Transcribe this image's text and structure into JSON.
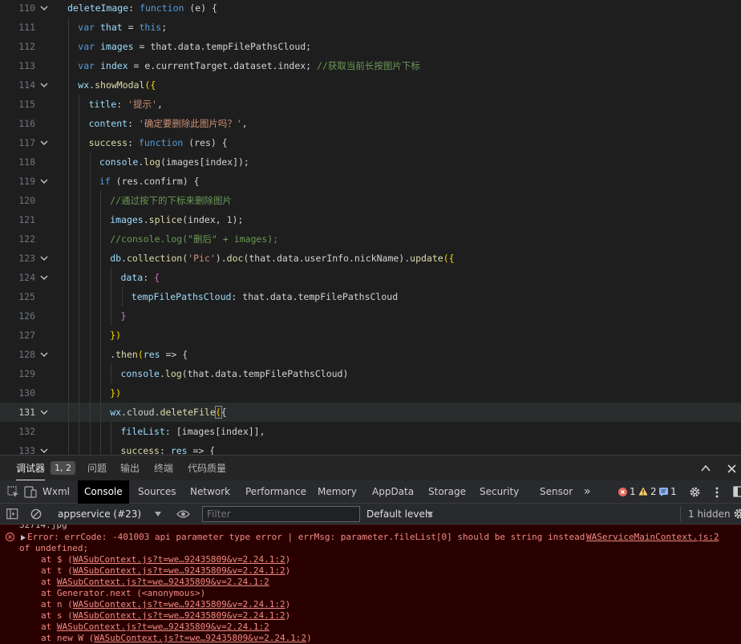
{
  "editor": {
    "lines": [
      {
        "num": "110",
        "indent": 0,
        "fold": true,
        "tokens": [
          [
            "prop",
            "deleteImage"
          ],
          [
            "punc",
            ": "
          ],
          [
            "kw",
            "function"
          ],
          [
            "punc",
            " (e) {"
          ]
        ]
      },
      {
        "num": "111",
        "indent": 1,
        "fold": false,
        "tokens": [
          [
            "kw",
            "var "
          ],
          [
            "var",
            "that"
          ],
          [
            "punc",
            " = "
          ],
          [
            "kw",
            "this"
          ],
          [
            "punc",
            ";"
          ]
        ]
      },
      {
        "num": "112",
        "indent": 1,
        "fold": false,
        "tokens": [
          [
            "kw",
            "var "
          ],
          [
            "var",
            "images"
          ],
          [
            "punc",
            " = that.data.tempFilePathsCloud;"
          ]
        ]
      },
      {
        "num": "113",
        "indent": 1,
        "fold": false,
        "tokens": [
          [
            "kw",
            "var "
          ],
          [
            "var",
            "index"
          ],
          [
            "punc",
            " = e.currentTarget.dataset.index; "
          ],
          [
            "com",
            "//获取当前长按图片下标"
          ]
        ]
      },
      {
        "num": "114",
        "indent": 1,
        "fold": true,
        "tokens": [
          [
            "var",
            "wx"
          ],
          [
            "punc",
            "."
          ],
          [
            "fn",
            "showModal"
          ],
          [
            "yel",
            "({"
          ]
        ]
      },
      {
        "num": "115",
        "indent": 2,
        "fold": false,
        "tokens": [
          [
            "prop",
            "title"
          ],
          [
            "punc",
            ": "
          ],
          [
            "str",
            "'提示'"
          ],
          [
            "punc",
            ","
          ]
        ]
      },
      {
        "num": "116",
        "indent": 2,
        "fold": false,
        "tokens": [
          [
            "prop",
            "content"
          ],
          [
            "punc",
            ": "
          ],
          [
            "str",
            "'确定要删除此图片吗？'"
          ],
          [
            "punc",
            ","
          ]
        ]
      },
      {
        "num": "117",
        "indent": 2,
        "fold": true,
        "tokens": [
          [
            "fn",
            "success"
          ],
          [
            "punc",
            ": "
          ],
          [
            "kw",
            "function"
          ],
          [
            "punc",
            " (res) {"
          ]
        ]
      },
      {
        "num": "118",
        "indent": 3,
        "fold": false,
        "tokens": [
          [
            "var",
            "console"
          ],
          [
            "punc",
            "."
          ],
          [
            "fn",
            "log"
          ],
          [
            "punc",
            "(images[index]);"
          ]
        ]
      },
      {
        "num": "119",
        "indent": 3,
        "fold": true,
        "tokens": [
          [
            "kw",
            "if"
          ],
          [
            "punc",
            " (res.confirm) {"
          ]
        ]
      },
      {
        "num": "120",
        "indent": 4,
        "fold": false,
        "tokens": [
          [
            "com",
            "//通过按下的下标来删除图片"
          ]
        ]
      },
      {
        "num": "121",
        "indent": 4,
        "fold": false,
        "tokens": [
          [
            "var",
            "images"
          ],
          [
            "punc",
            "."
          ],
          [
            "fn",
            "splice"
          ],
          [
            "punc",
            "(index, "
          ],
          [
            "num",
            "1"
          ],
          [
            "punc",
            ");"
          ]
        ]
      },
      {
        "num": "122",
        "indent": 4,
        "fold": false,
        "tokens": [
          [
            "com",
            "//console.log(\"删后\" + images);"
          ]
        ]
      },
      {
        "num": "123",
        "indent": 4,
        "fold": true,
        "tokens": [
          [
            "var",
            "db"
          ],
          [
            "punc",
            "."
          ],
          [
            "fn",
            "collection"
          ],
          [
            "punc",
            "("
          ],
          [
            "str",
            "'Pic'"
          ],
          [
            "punc",
            ")."
          ],
          [
            "fn",
            "doc"
          ],
          [
            "punc",
            "(that.data.userInfo.nickName)."
          ],
          [
            "fn",
            "update"
          ],
          [
            "yel",
            "({"
          ]
        ]
      },
      {
        "num": "124",
        "indent": 5,
        "fold": true,
        "tokens": [
          [
            "prop",
            "data"
          ],
          [
            "punc",
            ": "
          ],
          [
            "pur",
            "{"
          ]
        ]
      },
      {
        "num": "125",
        "indent": 6,
        "fold": false,
        "tokens": [
          [
            "prop",
            "tempFilePathsCloud"
          ],
          [
            "punc",
            ": that.data.tempFilePathsCloud"
          ]
        ]
      },
      {
        "num": "126",
        "indent": 5,
        "fold": false,
        "tokens": [
          [
            "pur",
            "}"
          ]
        ]
      },
      {
        "num": "127",
        "indent": 4,
        "fold": false,
        "tokens": [
          [
            "yel",
            "})"
          ]
        ]
      },
      {
        "num": "128",
        "indent": 4,
        "fold": true,
        "tokens": [
          [
            "punc",
            "."
          ],
          [
            "fn",
            "then"
          ],
          [
            "yel",
            "("
          ],
          [
            "var",
            "res"
          ],
          [
            "punc",
            " => {"
          ]
        ]
      },
      {
        "num": "129",
        "indent": 5,
        "fold": false,
        "tokens": [
          [
            "var",
            "console"
          ],
          [
            "punc",
            "."
          ],
          [
            "fn",
            "log"
          ],
          [
            "punc",
            "(that.data.tempFilePathsCloud)"
          ]
        ]
      },
      {
        "num": "130",
        "indent": 4,
        "fold": false,
        "tokens": [
          [
            "yel",
            "})"
          ]
        ]
      },
      {
        "num": "131",
        "indent": 4,
        "fold": true,
        "current": true,
        "tokens": [
          [
            "var",
            "wx"
          ],
          [
            "punc",
            ".cloud."
          ],
          [
            "fn",
            "deleteFile"
          ],
          [
            "yel",
            "("
          ],
          [
            "punc",
            "{"
          ]
        ]
      },
      {
        "num": "132",
        "indent": 5,
        "fold": false,
        "tokens": [
          [
            "prop",
            "fileList"
          ],
          [
            "punc",
            ": [images[index]],"
          ]
        ]
      },
      {
        "num": "133",
        "indent": 5,
        "fold": true,
        "tokens": [
          [
            "fn",
            "success"
          ],
          [
            "punc",
            ": "
          ],
          [
            "var",
            "res"
          ],
          [
            "punc",
            " => {"
          ]
        ]
      }
    ]
  },
  "panel": {
    "tabs": [
      {
        "label": "调试器",
        "active": true
      },
      {
        "label": "问题",
        "active": false
      },
      {
        "label": "输出",
        "active": false
      },
      {
        "label": "终端",
        "active": false
      },
      {
        "label": "代码质量",
        "active": false
      }
    ],
    "debugger_badge": "1, 2"
  },
  "devtools": {
    "tabs": [
      "Wxml",
      "Console",
      "Sources",
      "Network",
      "Performance",
      "Memory",
      "AppData",
      "Storage",
      "Security",
      "Sensor"
    ],
    "active_tab": "Console",
    "overflow": "»",
    "error_count": "1",
    "warning_count": "2",
    "info_count": "1"
  },
  "console_toolbar": {
    "context": "appservice (#23)",
    "filter_placeholder": "Filter",
    "levels": "Default levels",
    "hidden": "1 hidden"
  },
  "console": {
    "clipped_line": "32714.jpg",
    "error_message": "Error: errCode: -401003 api parameter type error | errMsg: parameter.fileList[0] should be string instead",
    "error_source": "WAServiceMainContext.js:2",
    "error_cont": "of undefined;",
    "stack": [
      {
        "prefix": "at $ (",
        "link": "WASubContext.js?t=we…92435809&v=2.24.1:2",
        "suffix": ")"
      },
      {
        "prefix": "at t (",
        "link": "WASubContext.js?t=we…92435809&v=2.24.1:2",
        "suffix": ")"
      },
      {
        "prefix": "at ",
        "link": "WASubContext.js?t=we…92435809&v=2.24.1:2",
        "suffix": ""
      },
      {
        "prefix": "at Generator.next (<anonymous>)",
        "link": "",
        "suffix": ""
      },
      {
        "prefix": "at n (",
        "link": "WASubContext.js?t=we…92435809&v=2.24.1:2",
        "suffix": ")"
      },
      {
        "prefix": "at s (",
        "link": "WASubContext.js?t=we…92435809&v=2.24.1:2",
        "suffix": ")"
      },
      {
        "prefix": "at ",
        "link": "WASubContext.js?t=we…92435809&v=2.24.1:2",
        "suffix": ""
      },
      {
        "prefix": "at new W (",
        "link": "WASubContext.js?t=we…92435809&v=2.24.1:2",
        "suffix": ")"
      }
    ]
  },
  "colors": {
    "error": "#f28b82",
    "warning": "#fdd663",
    "info": "#8ab4f8",
    "console_error_bg": "#290000"
  }
}
